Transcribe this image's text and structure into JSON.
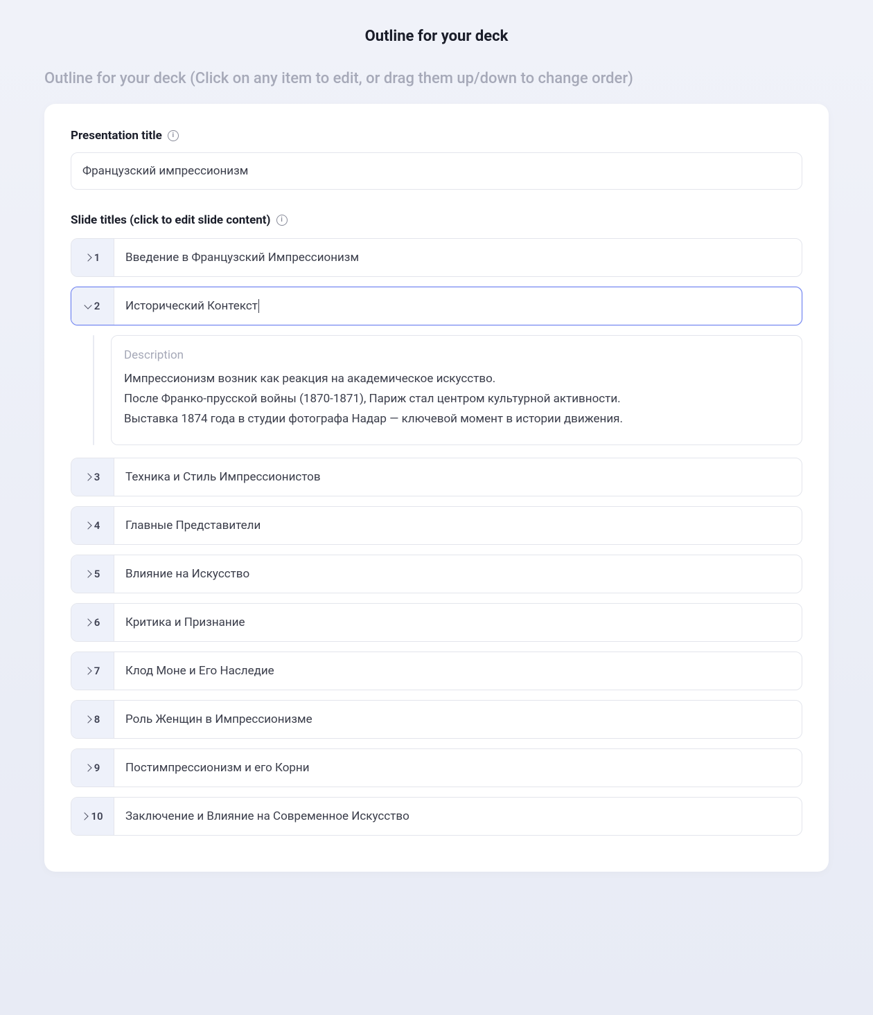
{
  "header": {
    "title": "Outline for your deck",
    "subtitle": "Outline for your deck (Click on any item to edit, or drag them up/down to change order)"
  },
  "presentation": {
    "label": "Presentation title",
    "value": "Французский импрессионизм"
  },
  "slidesSection": {
    "label": "Slide titles (click to edit slide content)",
    "descriptionLabel": "Description"
  },
  "slides": [
    {
      "num": "1",
      "title": "Введение в Французский Импрессионизм",
      "expanded": false
    },
    {
      "num": "2",
      "title": "Исторический Контекст",
      "expanded": true,
      "description": [
        "Импрессионизм возник как реакция на академическое искусство.",
        "После Франко-прусской войны (1870-1871), Париж стал центром культурной активности.",
        "Выставка 1874 года в студии фотографа Надар — ключевой момент в истории движения."
      ]
    },
    {
      "num": "3",
      "title": "Техника и Стиль Импрессионистов",
      "expanded": false
    },
    {
      "num": "4",
      "title": "Главные Представители",
      "expanded": false
    },
    {
      "num": "5",
      "title": "Влияние на Искусство",
      "expanded": false
    },
    {
      "num": "6",
      "title": "Критика и Признание",
      "expanded": false
    },
    {
      "num": "7",
      "title": "Клод Моне и Его Наследие",
      "expanded": false
    },
    {
      "num": "8",
      "title": "Роль Женщин в Импрессионизме",
      "expanded": false
    },
    {
      "num": "9",
      "title": "Постимпрессионизм и его Корни",
      "expanded": false
    },
    {
      "num": "10",
      "title": "Заключение и Влияние на Современное Искусство",
      "expanded": false
    }
  ]
}
